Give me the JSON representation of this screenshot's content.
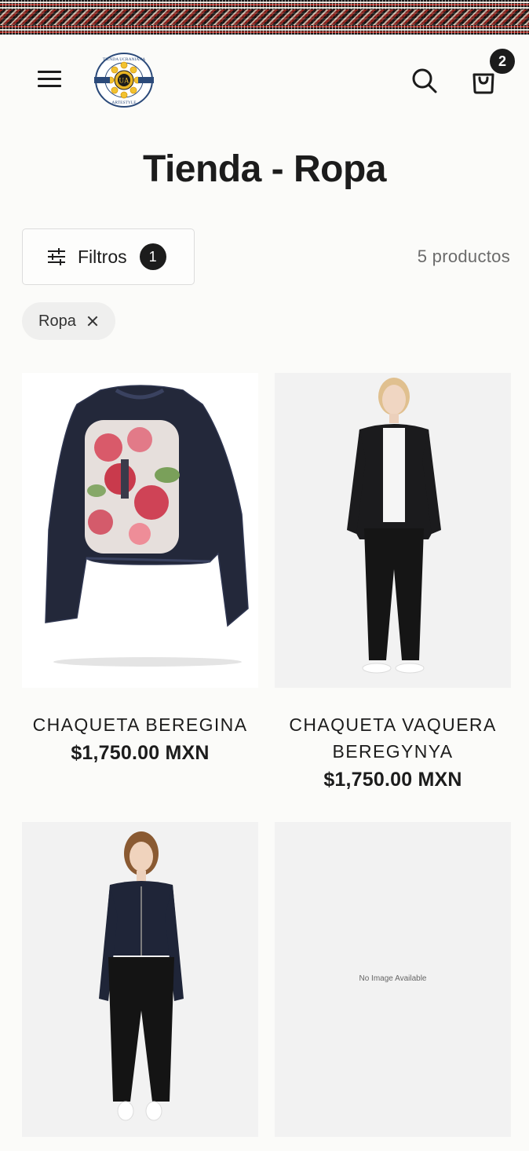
{
  "header": {
    "logo_text": "TIENDA UCRANIANA · UA · ARTESTYLE",
    "cart_count": "2",
    "icons": [
      "menu-icon",
      "search-icon",
      "cart-icon"
    ]
  },
  "page": {
    "title": "Tienda - Ropa"
  },
  "filters": {
    "button_label": "Filtros",
    "active_count": "1",
    "product_count": "5 productos",
    "active_chips": [
      {
        "label": "Ropa"
      }
    ]
  },
  "products": [
    {
      "title": "CHAQUETA BEREGINA",
      "price": "$1,750.00 MXN",
      "image": "embroidered-denim-jacket"
    },
    {
      "title": "CHAQUETA VAQUERA BEREGYNYA",
      "price": "$1,750.00 MXN",
      "image": "model-black-denim-jacket"
    },
    {
      "title": "",
      "price": "",
      "image": "model-dark-denim-jacket"
    },
    {
      "title": "",
      "price": "",
      "image": "no-image",
      "placeholder_text": "No Image Available"
    }
  ],
  "colors": {
    "text": "#1c1c1c",
    "background": "#fbfbf9",
    "accent": "#b3322a"
  }
}
